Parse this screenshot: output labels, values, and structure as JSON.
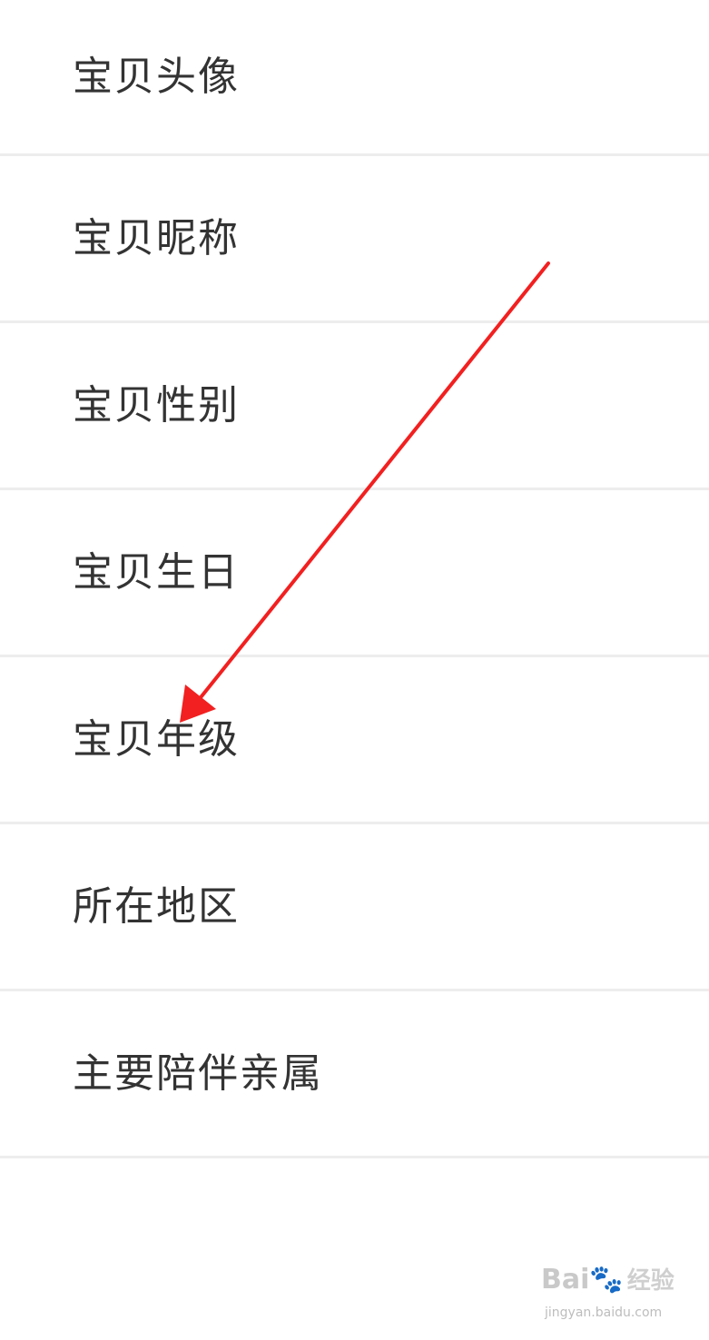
{
  "settings_list": {
    "items": [
      {
        "label": "宝贝头像"
      },
      {
        "label": "宝贝昵称"
      },
      {
        "label": "宝贝性别"
      },
      {
        "label": "宝贝生日"
      },
      {
        "label": "宝贝年级"
      },
      {
        "label": "所在地区"
      },
      {
        "label": "主要陪伴亲属"
      }
    ]
  },
  "annotation": {
    "arrow_color": "#f22020"
  },
  "watermark": {
    "brand": "Bai",
    "brand_suffix": "经验",
    "url": "jingyan.baidu.com"
  }
}
